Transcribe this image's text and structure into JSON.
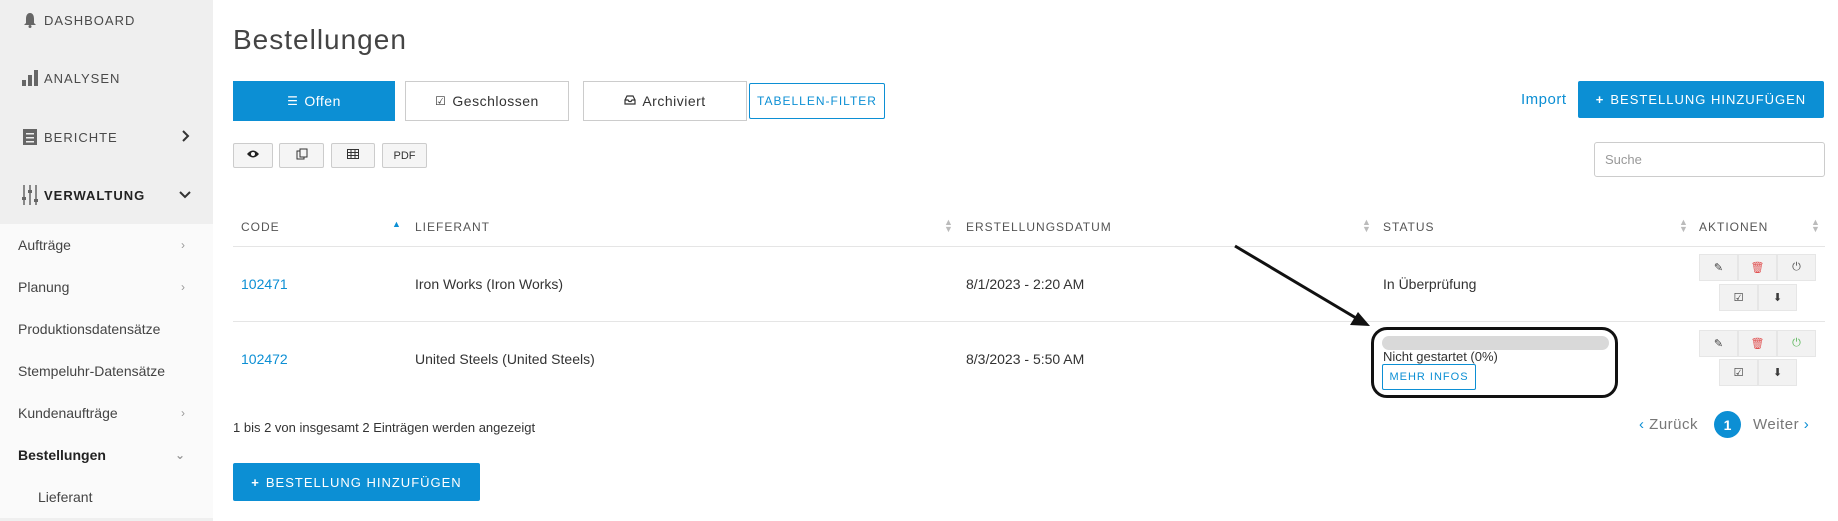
{
  "sidebar": {
    "top_items": [
      {
        "label": "DASHBOARD",
        "icon": "bell-icon"
      },
      {
        "label": "ANALYSEN",
        "icon": "bar-chart-icon"
      },
      {
        "label": "BERICHTE",
        "icon": "report-icon"
      },
      {
        "label": "VERWALTUNG",
        "icon": "sliders-icon"
      }
    ],
    "sub_items": [
      {
        "label": "Aufträge"
      },
      {
        "label": "Planung"
      },
      {
        "label": "Produktionsdatensätze"
      },
      {
        "label": "Stempeluhr-Datensätze"
      },
      {
        "label": "Kundenaufträge"
      },
      {
        "label": "Bestellungen"
      },
      {
        "label": "Lieferant"
      }
    ]
  },
  "page": {
    "title": "Bestellungen"
  },
  "tabs": [
    {
      "label": "Offen",
      "icon": "list-icon",
      "active": true
    },
    {
      "label": "Geschlossen",
      "icon": "checkbox-icon",
      "active": false
    },
    {
      "label": "Archiviert",
      "icon": "inbox-icon",
      "active": false
    }
  ],
  "toolbar": {
    "filter_label": "TABELLEN-FILTER",
    "import_label": "Import",
    "add_label": "BESTELLUNG HINZUFÜGEN",
    "pdf_label": "PDF",
    "search_placeholder": "Suche"
  },
  "table": {
    "columns": [
      "CODE",
      "LIEFERANT",
      "ERSTELLUNGSDATUM",
      "STATUS",
      "AKTIONEN"
    ],
    "rows": [
      {
        "code": "102471",
        "supplier": "Iron Works (Iron Works)",
        "date": "8/1/2023 - 2:20 AM",
        "status": "In Überprüfung"
      },
      {
        "code": "102472",
        "supplier": "United Steels (United Steels)",
        "date": "8/3/2023 - 5:50 AM",
        "status": "Nicht gestartet (0%)",
        "progress": 0,
        "more_label": "MEHR INFOS"
      }
    ]
  },
  "footer": {
    "info": "1 bis 2 von insgesamt 2 Einträgen werden angezeigt",
    "prev_label": "Zurück",
    "next_label": "Weiter",
    "current_page": "1",
    "add_label": "BESTELLUNG HINZUFÜGEN"
  },
  "colors": {
    "accent": "#0c8fd4",
    "sidebar_bg": "#efefef",
    "delete_red": "#e05050",
    "power_green": "#5cb85c"
  }
}
